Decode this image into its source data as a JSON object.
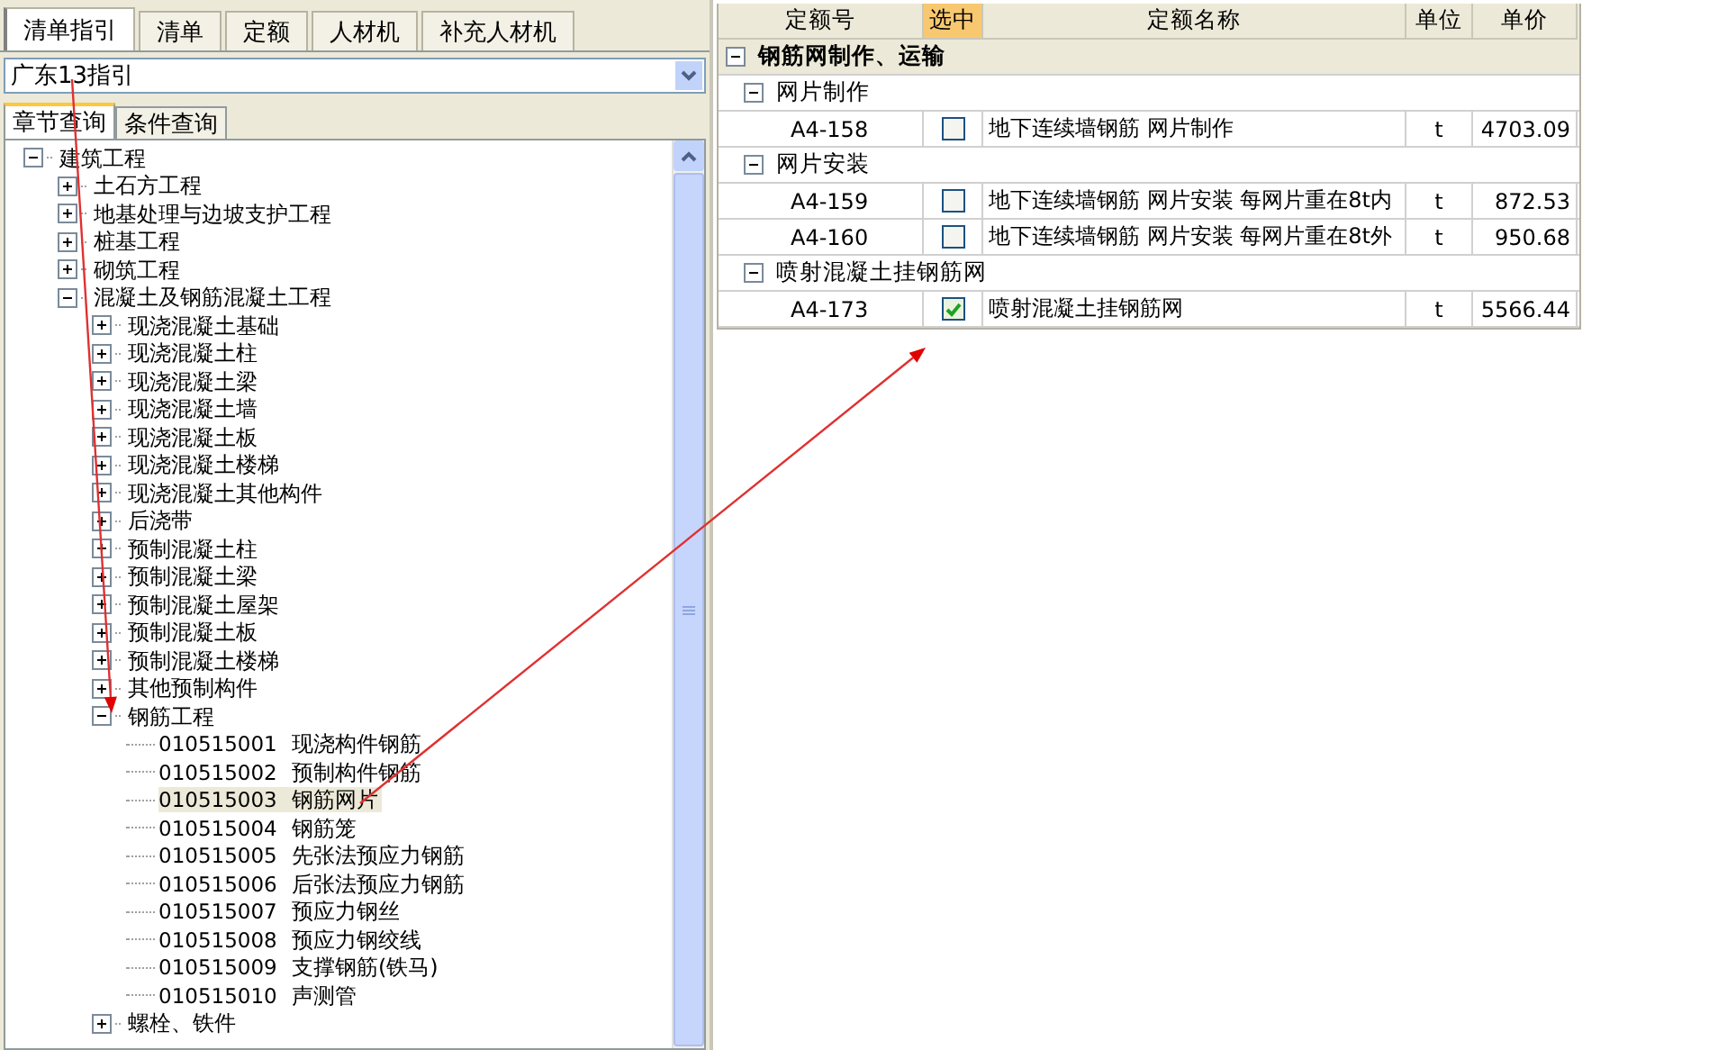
{
  "top_tabs": [
    {
      "label": "清单指引",
      "selected": true
    },
    {
      "label": "清单",
      "selected": false
    },
    {
      "label": "定额",
      "selected": false
    },
    {
      "label": "人材机",
      "selected": false
    },
    {
      "label": "补充人材机",
      "selected": false
    }
  ],
  "guide_select": {
    "value": "广东13指引"
  },
  "query_tabs": [
    {
      "label": "章节查询",
      "selected": true
    },
    {
      "label": "条件查询",
      "selected": false
    }
  ],
  "tree": [
    {
      "label": "建筑工程",
      "expanded": true,
      "children": [
        {
          "label": "土石方工程",
          "expanded": false
        },
        {
          "label": "地基处理与边坡支护工程",
          "expanded": false
        },
        {
          "label": "桩基工程",
          "expanded": false
        },
        {
          "label": "砌筑工程",
          "expanded": false
        },
        {
          "label": "混凝土及钢筋混凝土工程",
          "expanded": true,
          "children": [
            {
              "label": "现浇混凝土基础",
              "expanded": false
            },
            {
              "label": "现浇混凝土柱",
              "expanded": false
            },
            {
              "label": "现浇混凝土梁",
              "expanded": false
            },
            {
              "label": "现浇混凝土墙",
              "expanded": false
            },
            {
              "label": "现浇混凝土板",
              "expanded": false
            },
            {
              "label": "现浇混凝土楼梯",
              "expanded": false
            },
            {
              "label": "现浇混凝土其他构件",
              "expanded": false
            },
            {
              "label": "后浇带",
              "expanded": false
            },
            {
              "label": "预制混凝土柱",
              "expanded": false
            },
            {
              "label": "预制混凝土梁",
              "expanded": false
            },
            {
              "label": "预制混凝土屋架",
              "expanded": false
            },
            {
              "label": "预制混凝土板",
              "expanded": false
            },
            {
              "label": "预制混凝土楼梯",
              "expanded": false
            },
            {
              "label": "其他预制构件",
              "expanded": false
            },
            {
              "label": "钢筋工程",
              "expanded": true,
              "children": [
                {
                  "code": "010515001",
                  "label": "现浇构件钢筋",
                  "selected": false
                },
                {
                  "code": "010515002",
                  "label": "预制构件钢筋",
                  "selected": false
                },
                {
                  "code": "010515003",
                  "label": "钢筋网片",
                  "selected": true
                },
                {
                  "code": "010515004",
                  "label": "钢筋笼",
                  "selected": false
                },
                {
                  "code": "010515005",
                  "label": "先张法预应力钢筋",
                  "selected": false
                },
                {
                  "code": "010515006",
                  "label": "后张法预应力钢筋",
                  "selected": false
                },
                {
                  "code": "010515007",
                  "label": "预应力钢丝",
                  "selected": false
                },
                {
                  "code": "010515008",
                  "label": "预应力钢绞线",
                  "selected": false
                },
                {
                  "code": "010515009",
                  "label": "支撑钢筋(铁马)",
                  "selected": false
                },
                {
                  "code": "010515010",
                  "label": "声测管",
                  "selected": false
                }
              ]
            },
            {
              "label": "螺栓、铁件",
              "expanded": false
            }
          ]
        }
      ]
    }
  ],
  "table": {
    "columns": [
      {
        "label": "定额号",
        "highlighted": false
      },
      {
        "label": "选中",
        "highlighted": true
      },
      {
        "label": "定额名称",
        "highlighted": false
      },
      {
        "label": "单位",
        "highlighted": false
      },
      {
        "label": "单价",
        "highlighted": false
      }
    ],
    "groups": [
      {
        "title": "钢筋网制作、运输",
        "expanded": true,
        "children": [
          {
            "title": "网片制作",
            "expanded": true,
            "rows": [
              {
                "code": "A4-158",
                "checked": false,
                "name": "地下连续墙钢筋 网片制作",
                "unit": "t",
                "price": "4703.09"
              }
            ]
          },
          {
            "title": "网片安装",
            "expanded": true,
            "rows": [
              {
                "code": "A4-159",
                "checked": false,
                "name": "地下连续墙钢筋 网片安装 每网片重在8t内",
                "unit": "t",
                "price": "872.53"
              },
              {
                "code": "A4-160",
                "checked": false,
                "name": "地下连续墙钢筋 网片安装 每网片重在8t外",
                "unit": "t",
                "price": "950.68"
              }
            ]
          },
          {
            "title": "喷射混凝土挂钢筋网",
            "expanded": true,
            "rows": [
              {
                "code": "A4-173",
                "checked": true,
                "name": "喷射混凝土挂钢筋网",
                "unit": "t",
                "price": "5566.44"
              }
            ]
          }
        ]
      }
    ]
  }
}
